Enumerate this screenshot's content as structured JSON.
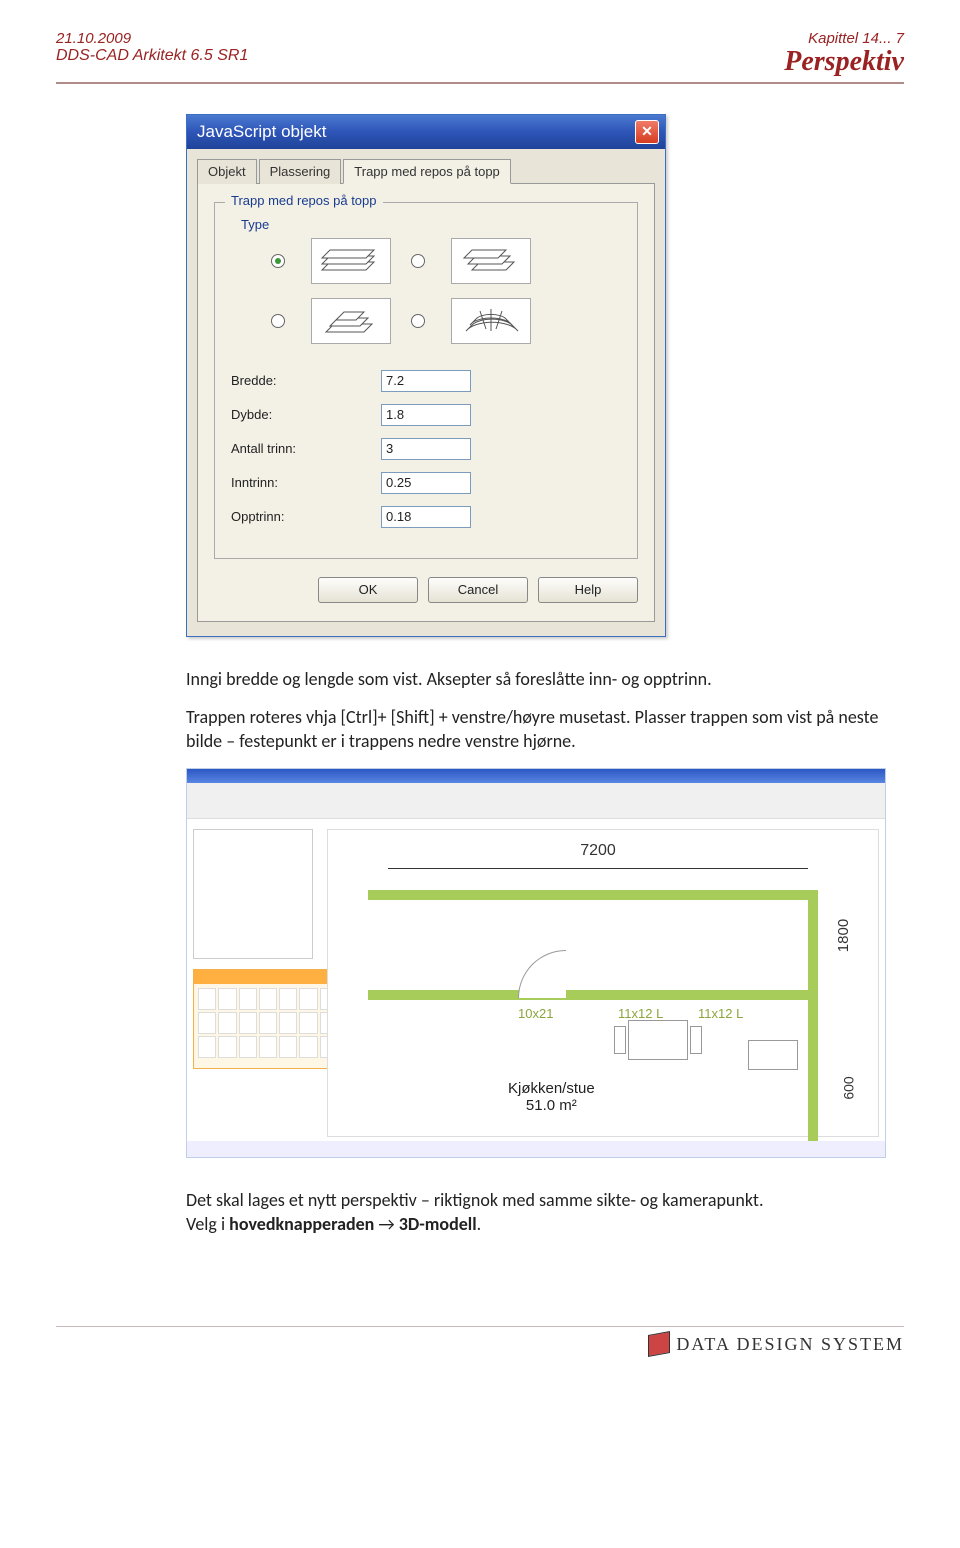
{
  "header": {
    "date": "21.10.2009",
    "chapter": "Kapittel 14... 7",
    "product": "DDS-CAD Arkitekt  6.5 SR1",
    "page_title": "Perspektiv"
  },
  "dialog": {
    "title": "JavaScript objekt",
    "tabs": [
      "Objekt",
      "Plassering",
      "Trapp med repos på topp"
    ],
    "active_tab": 2,
    "groupbox_title": "Trapp med repos på topp",
    "type_label": "Type",
    "fields": {
      "bredde": {
        "label": "Bredde:",
        "value": "7.2"
      },
      "dybde": {
        "label": "Dybde:",
        "value": "1.8"
      },
      "antall_trinn": {
        "label": "Antall trinn:",
        "value": "3"
      },
      "inntrinn": {
        "label": "Inntrinn:",
        "value": "0.25"
      },
      "opptrinn": {
        "label": "Opptrinn:",
        "value": "0.18"
      }
    },
    "buttons": {
      "ok": "OK",
      "cancel": "Cancel",
      "help": "Help"
    }
  },
  "paragraph1": "Inngi bredde og lengde som vist. Aksepter så foreslåtte inn- og opptrinn.",
  "paragraph2": "Trappen roteres vhja [Ctrl]+ [Shift] + venstre/høyre musetast. Plasser trappen som vist på neste bilde – festepunkt er i trappens nedre venstre hjørne.",
  "plan": {
    "dim_top": "7200",
    "dim_right1": "1800",
    "dim_right2": "600",
    "door_label": "10x21",
    "win1_label": "11x12 L",
    "win2_label": "11x12 L",
    "room_name": "Kjøkken/stue",
    "room_area": "51.0 m²"
  },
  "paragraph3a": "Det skal lages et nytt perspektiv – riktignok med samme sikte- og kamerapunkt.",
  "paragraph3b_prefix": "Velg i ",
  "paragraph3b_bold1": "hovedknapperaden",
  "paragraph3b_arrow": " → ",
  "paragraph3b_bold2": "3D-modell",
  "paragraph3b_suffix": ".",
  "footer": {
    "brand": "DATA DESIGN SYSTEM"
  }
}
